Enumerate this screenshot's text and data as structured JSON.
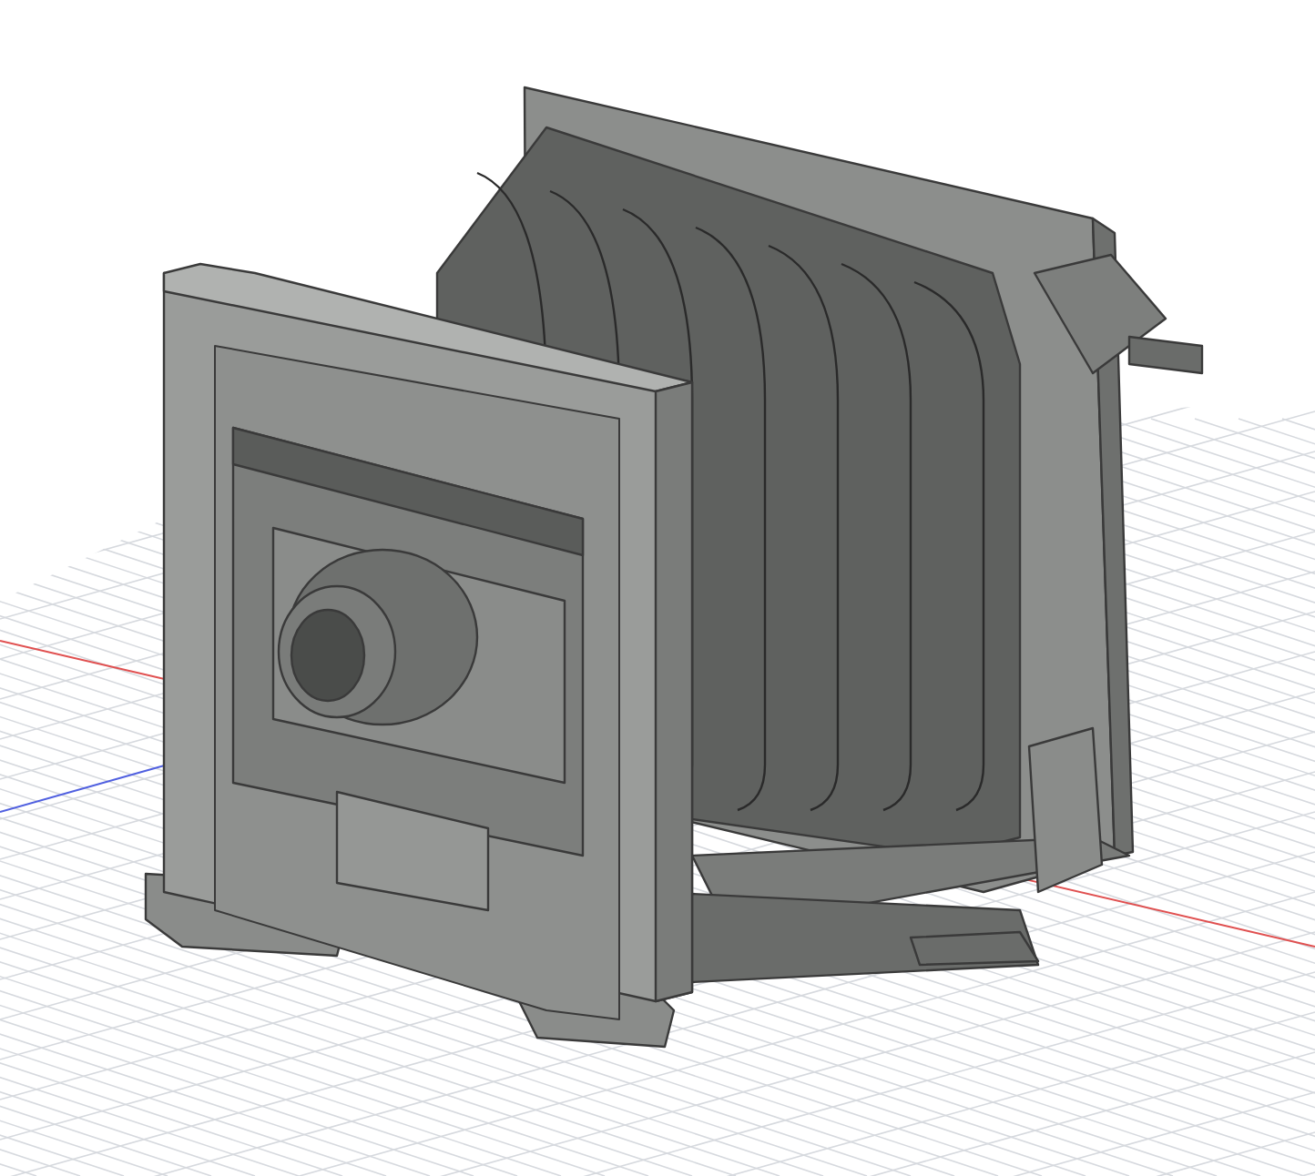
{
  "viewport": {
    "grid": true,
    "axes": true,
    "model": {
      "kind": "bellows-camera"
    }
  }
}
